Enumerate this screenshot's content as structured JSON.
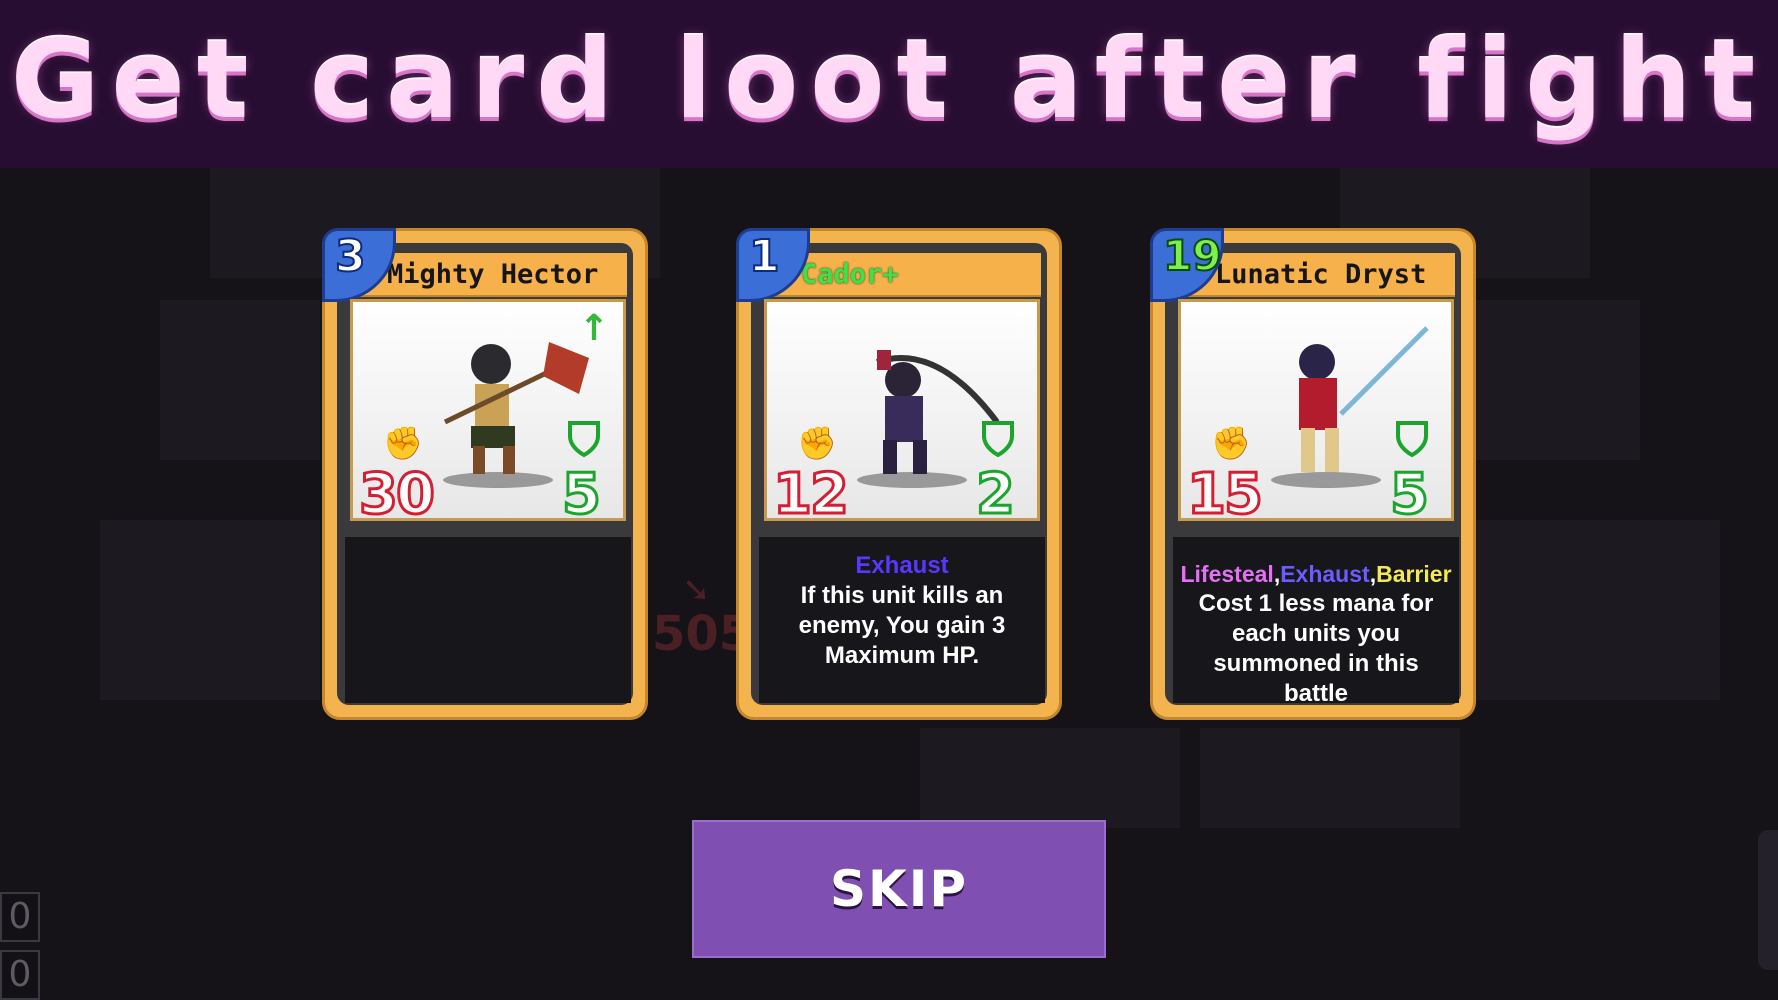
{
  "banner": {
    "title": "Get card loot after fight"
  },
  "board": {
    "ghost_damage": "505"
  },
  "cards": [
    {
      "cost": "3",
      "name": "Mighty Hector",
      "name_upgraded": false,
      "attack": "30",
      "defense": "5",
      "has_upgrade_arrow": true,
      "keywords": [],
      "text": ""
    },
    {
      "cost": "1",
      "name": "Cador+",
      "name_upgraded": true,
      "attack": "12",
      "defense": "2",
      "keywords": [
        "Exhaust"
      ],
      "text": "If this unit kills an enemy, You gain 3 Maximum HP."
    },
    {
      "cost": "19",
      "name": "Lunatic Dryst",
      "name_upgraded": false,
      "attack": "15",
      "defense": "5",
      "keywords": [
        "Lifesteal",
        "Exhaust",
        "Barrier"
      ],
      "text": "Cost 1 less mana for each units you summoned in this battle"
    }
  ],
  "skip_button": {
    "label": "SKIP"
  },
  "side_counters": [
    "0",
    "0"
  ],
  "colors": {
    "banner": "#280d32",
    "card_frame": "#f3b450",
    "mana": "#3b6fd7",
    "skip": "#7f4fb2"
  }
}
